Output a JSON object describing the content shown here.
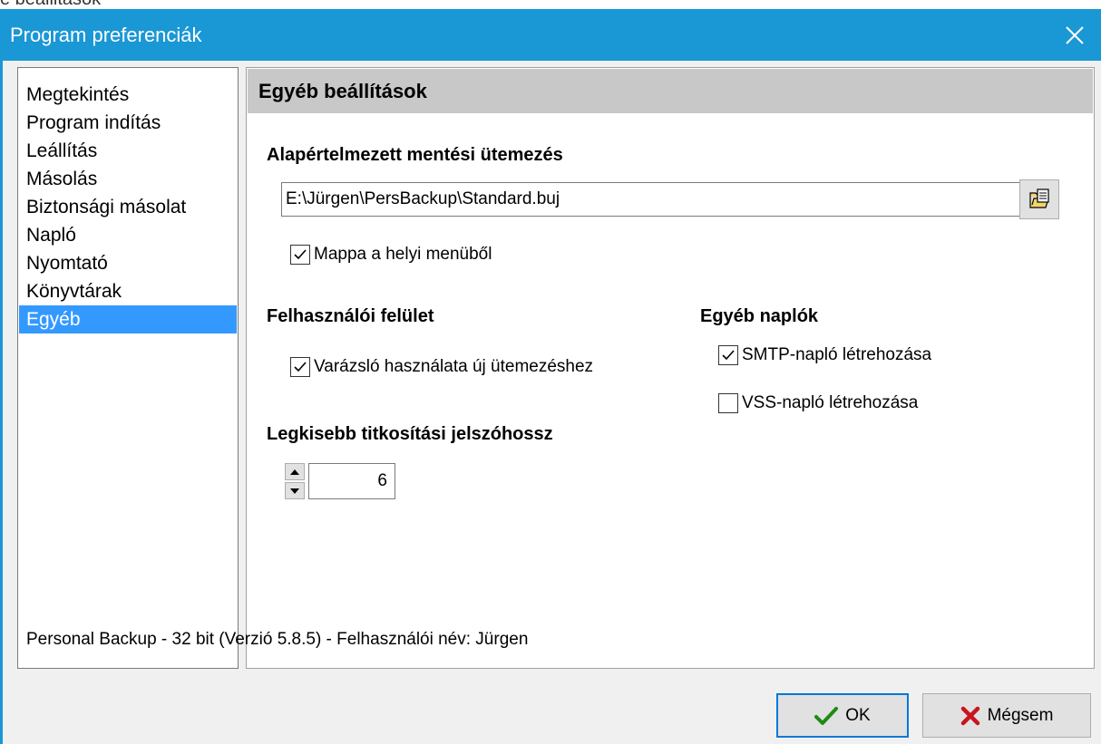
{
  "background_strip": {
    "text": "e beallitasok"
  },
  "window": {
    "title": "Program preferenciák",
    "accent_color": "#1a97d5"
  },
  "nav": {
    "items": [
      {
        "label": "Megtekintés",
        "selected": false
      },
      {
        "label": "Program indítás",
        "selected": false
      },
      {
        "label": "Leállítás",
        "selected": false
      },
      {
        "label": "Másolás",
        "selected": false
      },
      {
        "label": "Biztonsági másolat",
        "selected": false
      },
      {
        "label": "Napló",
        "selected": false
      },
      {
        "label": "Nyomtató",
        "selected": false
      },
      {
        "label": "Könyvtárak",
        "selected": false
      },
      {
        "label": "Egyéb",
        "selected": true
      }
    ]
  },
  "panel": {
    "title": "Egyéb beállítások",
    "default_schedule": {
      "label": "Alapértelmezett mentési ütemezés",
      "path": "E:\\Jürgen\\PersBackup\\Standard.buj",
      "browse_icon": "open-file-icon"
    },
    "folder_context_menu": {
      "label": "Mappa a helyi menüből",
      "checked": true
    },
    "ui_section": {
      "label": "Felhasználói felület",
      "wizard": {
        "label": "Varázsló használata új ütemezéshez",
        "checked": true
      }
    },
    "other_logs": {
      "label": "Egyéb naplók",
      "smtp": {
        "label": "SMTP-napló létrehozása",
        "checked": true
      },
      "vss": {
        "label": "VSS-napló létrehozása",
        "checked": false
      }
    },
    "min_password": {
      "label": "Legkisebb titkosítási jelszóhossz",
      "value": "6"
    }
  },
  "status": {
    "text": "Personal Backup - 32 bit (Verzió 5.8.5) - Felhasználói név: Jürgen"
  },
  "buttons": {
    "ok": {
      "label": "OK",
      "icon": "checkmark-icon"
    },
    "cancel": {
      "label": "Mégsem",
      "icon": "cross-icon"
    }
  }
}
